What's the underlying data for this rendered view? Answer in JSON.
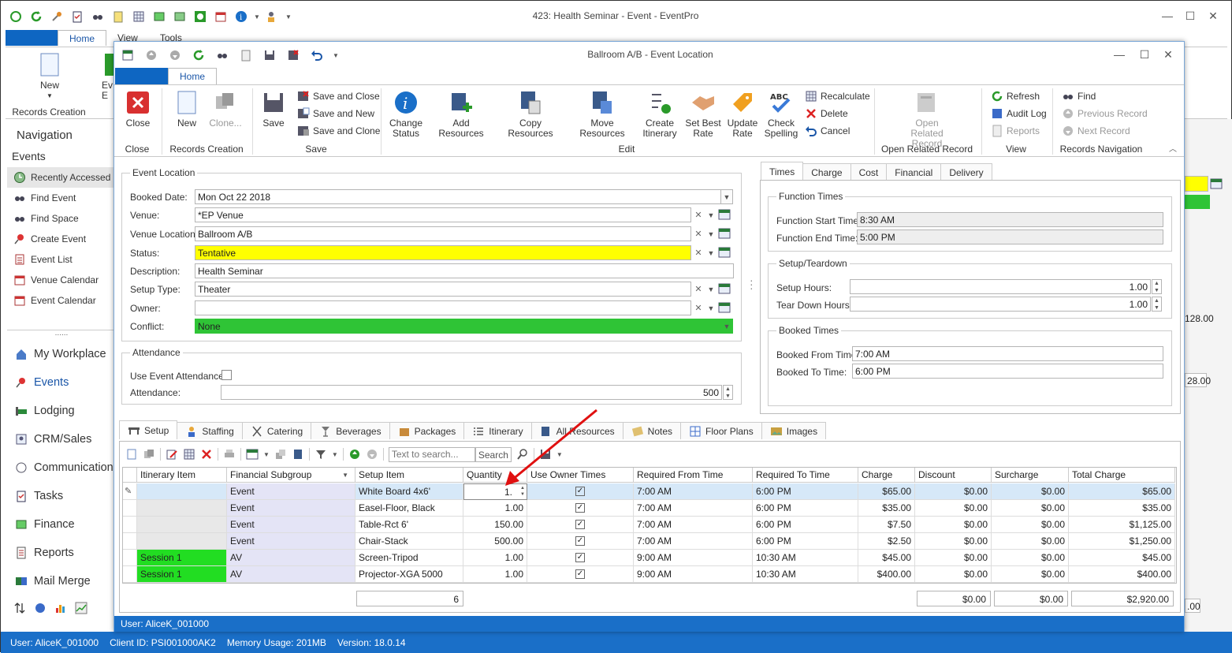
{
  "outer": {
    "title": "423: Health Seminar - Event - EventPro",
    "tabs": [
      "Home",
      "View",
      "Tools"
    ],
    "ribbon": {
      "new_label": "New",
      "ev_label": "Ev",
      "ev_label2": "E",
      "group": "Records Creation"
    },
    "nav": {
      "header": "Navigation",
      "sub": "Events",
      "items": [
        "Recently Accessed Events",
        "Find Event",
        "Find Space",
        "Create Event",
        "Event List",
        "Venue Calendar",
        "Event Calendar"
      ],
      "grip": "......",
      "modules": [
        "My Workplace",
        "Events",
        "Lodging",
        "CRM/Sales",
        "Communications",
        "Tasks",
        "Finance",
        "Reports",
        "Mail Merge"
      ]
    },
    "right_partial": [
      "128.00",
      "28.00",
      ".00"
    ],
    "status": {
      "user": "User: AliceK_001000",
      "client": "Client ID: PSI001000AK2",
      "memory": "Memory Usage: 201MB",
      "version": "Version: 18.0.14"
    }
  },
  "dialog": {
    "title": "Ballroom A/B - Event Location",
    "tab": "Home",
    "ribbon": {
      "close": "Close",
      "close_group": "Close",
      "new": "New",
      "clone": "Clone...",
      "records_group": "Records Creation",
      "save": "Save",
      "save_close": "Save and Close",
      "save_new": "Save and New",
      "save_clone": "Save and Clone",
      "save_group": "Save",
      "change_status": "Change Status",
      "add_resources": "Add Resources",
      "copy_resources": "Copy Resources",
      "move_resources": "Move Resources",
      "create_itinerary": "Create Itinerary",
      "set_best_rate": "Set Best Rate",
      "update_rate": "Update Rate",
      "check_spelling": "Check Spelling",
      "recalculate": "Recalculate",
      "delete": "Delete",
      "cancel": "Cancel",
      "edit_group": "Edit",
      "open_related": "Open Related Record",
      "open_related_group": "Open Related Record",
      "refresh": "Refresh",
      "audit_log": "Audit Log",
      "reports": "Reports",
      "view_group": "View",
      "find": "Find",
      "prev_record": "Previous Record",
      "next_record": "Next Record",
      "nav_group": "Records Navigation"
    },
    "event_location": {
      "title": "Event Location",
      "booked_date_label": "Booked Date:",
      "booked_date": "Mon Oct 22 2018",
      "venue_label": "Venue:",
      "venue": "*EP Venue",
      "venue_location_label": "Venue Location:",
      "venue_location": "Ballroom A/B",
      "status_label": "Status:",
      "status": "Tentative",
      "description_label": "Description:",
      "description": "Health Seminar",
      "setup_type_label": "Setup Type:",
      "setup_type": "Theater",
      "owner_label": "Owner:",
      "owner": "",
      "conflict_label": "Conflict:",
      "conflict": "None"
    },
    "attendance": {
      "title": "Attendance",
      "use_event_label": "Use Event Attendance",
      "attendance_label": "Attendance:",
      "attendance": "500"
    },
    "right_tabs": [
      "Times",
      "Charge",
      "Cost",
      "Financial",
      "Delivery"
    ],
    "times": {
      "function_title": "Function Times",
      "start_label": "Function Start Time:",
      "start": "8:30 AM",
      "end_label": "Function End Time:",
      "end": "5:00 PM",
      "setup_title": "Setup/Teardown",
      "setup_hours_label": "Setup Hours:",
      "setup_hours": "1.00",
      "teardown_label": "Tear Down Hours:",
      "teardown": "1.00",
      "booked_title": "Booked Times",
      "booked_from_label": "Booked From Time:",
      "booked_from": "7:00 AM",
      "booked_to_label": "Booked To Time:",
      "booked_to": "6:00 PM"
    },
    "bottom_tabs": [
      "Setup",
      "Staffing",
      "Catering",
      "Beverages",
      "Packages",
      "Itinerary",
      "All Resources",
      "Notes",
      "Floor Plans",
      "Images"
    ],
    "search": {
      "placeholder": "Text to search...",
      "button": "Search"
    },
    "grid": {
      "columns": [
        "Itinerary Item",
        "Financial Subgroup",
        "Setup Item",
        "Quantity",
        "Use Owner Times",
        "Required From Time",
        "Required To Time",
        "Charge",
        "Discount",
        "Surcharge",
        "Total Charge"
      ],
      "rows": [
        {
          "itinerary": "",
          "subgroup": "Event",
          "item": "White Board 4x6'",
          "qty": "1.",
          "owner": true,
          "from": "7:00 AM",
          "to": "6:00 PM",
          "charge": "$65.00",
          "discount": "$0.00",
          "surcharge": "$0.00",
          "total": "$65.00"
        },
        {
          "itinerary": "",
          "subgroup": "Event",
          "item": "Easel-Floor, Black",
          "qty": "1.00",
          "owner": true,
          "from": "7:00 AM",
          "to": "6:00 PM",
          "charge": "$35.00",
          "discount": "$0.00",
          "surcharge": "$0.00",
          "total": "$35.00"
        },
        {
          "itinerary": "",
          "subgroup": "Event",
          "item": "Table-Rct 6'",
          "qty": "150.00",
          "owner": true,
          "from": "7:00 AM",
          "to": "6:00 PM",
          "charge": "$7.50",
          "discount": "$0.00",
          "surcharge": "$0.00",
          "total": "$1,125.00"
        },
        {
          "itinerary": "",
          "subgroup": "Event",
          "item": "Chair-Stack",
          "qty": "500.00",
          "owner": true,
          "from": "7:00 AM",
          "to": "6:00 PM",
          "charge": "$2.50",
          "discount": "$0.00",
          "surcharge": "$0.00",
          "total": "$1,250.00"
        },
        {
          "itinerary": "Session 1",
          "subgroup": "AV",
          "item": "Screen-Tripod",
          "qty": "1.00",
          "owner": true,
          "from": "9:00 AM",
          "to": "10:30 AM",
          "charge": "$45.00",
          "discount": "$0.00",
          "surcharge": "$0.00",
          "total": "$45.00"
        },
        {
          "itinerary": "Session 1",
          "subgroup": "AV",
          "item": "Projector-XGA 5000",
          "qty": "1.00",
          "owner": true,
          "from": "9:00 AM",
          "to": "10:30 AM",
          "charge": "$400.00",
          "discount": "$0.00",
          "surcharge": "$0.00",
          "total": "$400.00"
        }
      ],
      "footer": {
        "count": "6",
        "discount": "$0.00",
        "surcharge": "$0.00",
        "total": "$2,920.00"
      }
    },
    "status": "User: AliceK_001000"
  },
  "colors": {
    "accent": "#1a6fc8",
    "status_yellow": "#ffff00",
    "conflict_green": "#2fc436",
    "session_green": "#22dd22",
    "subgroup_bg": "#e4e4f6",
    "selected_row": "#d6e8f8"
  }
}
